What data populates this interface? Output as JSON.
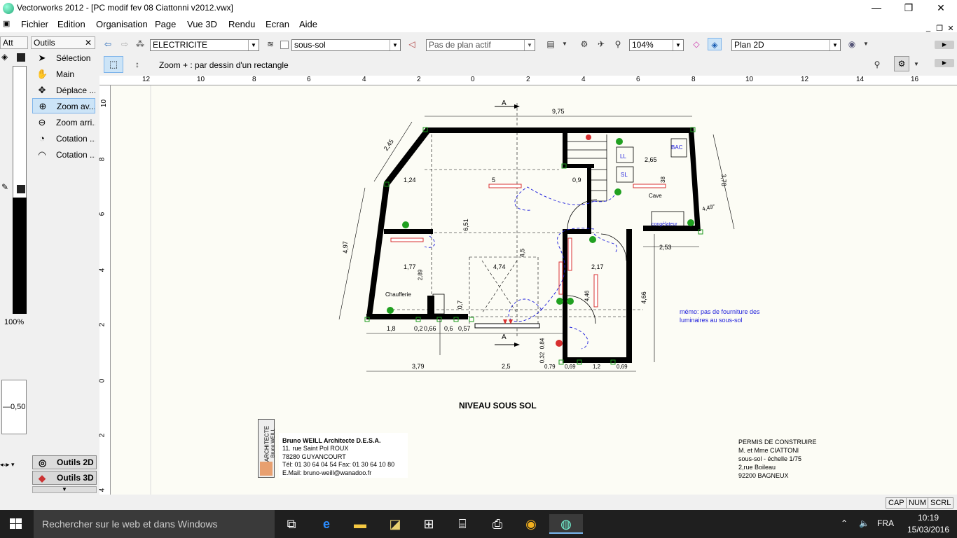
{
  "window": {
    "title": "Vectorworks 2012 - [PC modif fev 08 Ciattonni v2012.vwx]",
    "minimize": "—",
    "maximize": "❐",
    "close": "✕"
  },
  "menu": {
    "items": [
      "Fichier",
      "Edition",
      "Organisation",
      "Page",
      "Vue 3D",
      "Rendu",
      "Ecran",
      "Aide"
    ]
  },
  "toolbar": {
    "class_value": "ELECTRICITE",
    "layer_value": "sous-sol",
    "plan_value": "Pas de plan actif",
    "zoom_value": "104%",
    "view_value": "Plan 2D"
  },
  "mode_bar": {
    "hint": "Zoom + : par dessin d'un rectangle"
  },
  "att_palette": {
    "title": "Att",
    "percent": "100%",
    "line_weight": "0,50"
  },
  "tools_palette": {
    "title": "Outils",
    "items": [
      {
        "label": "Sélection",
        "icon": "arrow-pointer-icon"
      },
      {
        "label": "Main",
        "icon": "hand-icon"
      },
      {
        "label": "Déplace ...",
        "icon": "move-view-icon"
      },
      {
        "label": "Zoom av...",
        "icon": "zoom-in-icon"
      },
      {
        "label": "Zoom arri...",
        "icon": "zoom-out-icon"
      },
      {
        "label": "Cotation ...",
        "icon": "dimension-icon"
      },
      {
        "label": "Cotation ...",
        "icon": "angular-dimension-icon"
      }
    ],
    "set_2d": "Outils 2D",
    "set_3d": "Outils 3D"
  },
  "rulers": {
    "top": [
      "12",
      "10",
      "8",
      "6",
      "4",
      "2",
      "0",
      "2",
      "4",
      "6",
      "8",
      "10",
      "12",
      "14",
      "16"
    ],
    "left": [
      "10",
      "8",
      "6",
      "4",
      "2",
      "0",
      "2",
      "4"
    ]
  },
  "drawing": {
    "title": "NIVEAU SOUS SOL",
    "section_a": "A",
    "dims": {
      "d975": "9,75",
      "d245": "2,45",
      "d124": "1,24",
      "d5": "5",
      "d09": "0,9",
      "d265": "2,65",
      "d378": "3,78",
      "d38": "38",
      "d449": "4,49°",
      "d497": "4,97",
      "d651": "6,51",
      "d45": "4,5",
      "d474": "4,74",
      "d177": "1,77",
      "d289": "2,89",
      "d217": "2,17",
      "d446": "4,46",
      "d253": "2,53",
      "d466": "4,66",
      "d07": "0,7",
      "d18": "1,8",
      "d02": "0,2",
      "d066": "0,66",
      "d06": "0,6",
      "d057": "0,57",
      "d084": "0,84",
      "d032": "0,32",
      "d379": "3,79",
      "d25": "2,5",
      "d079": "0,79",
      "d069": "0,69",
      "d12": "1,2",
      "d069b": "0,69"
    },
    "rooms": {
      "cave": "Cave",
      "chaufferie": "Chaufferie",
      "ll": "LL",
      "sl": "SL",
      "bac": "BAC",
      "congelateur": "congélateur"
    },
    "memo_line1": "mémo: pas de fourniture des",
    "memo_line2": "luminaires au sous-sol",
    "architect": {
      "stamp1": "ARCHITECTE",
      "stamp2": "Bruno WEILL",
      "name": "Bruno WEILL Architecte D.E.S.A.",
      "address1": "11. rue Saint Pol ROUX",
      "address2": "78280 GUYANCOURT",
      "phone": "Tél: 01 30 64 04 54 Fax: 01 30 64 10 80",
      "email": "E.Mail: bruno-weill@wanadoo.fr"
    },
    "permit": {
      "line1": "PERMIS DE CONSTRUIRE",
      "line2": "M. et Mme CIATTONI",
      "line3": "sous-sol - échelle 1/75",
      "line4": "2,rue Boileau",
      "line5": "92200 BAGNEUX"
    }
  },
  "status": {
    "cap": "CAP",
    "num": "NUM",
    "scrl": "SCRL"
  },
  "taskbar": {
    "search": "Rechercher sur le web et dans Windows",
    "lang": "FRA",
    "time": "10:19",
    "date": "15/03/2016"
  },
  "colors": {
    "accent": "#0078d7",
    "wall": "#000000",
    "wiring": "#1a1adb",
    "heater": "#d83030",
    "switch": "#20a020"
  }
}
